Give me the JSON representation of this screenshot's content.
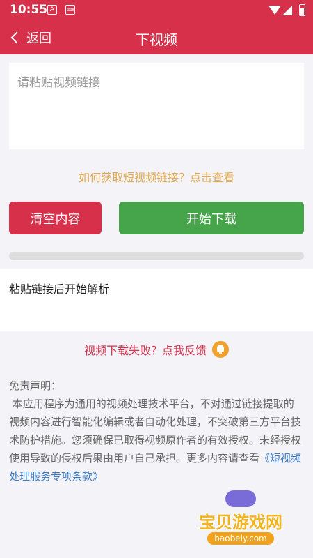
{
  "status_bar": {
    "time": "10:55",
    "notif_icons": [
      "A",
      "keyboard-icon"
    ],
    "system_icons": [
      "wifi-icon",
      "signal-icon",
      "battery-icon"
    ]
  },
  "app_bar": {
    "back_label": "返回",
    "title": "下视频"
  },
  "link_input": {
    "placeholder": "请粘贴视频链接",
    "value": ""
  },
  "howto_link": "如何获取短视频链接？点击查看",
  "actions": {
    "clear_label": "清空内容",
    "start_label": "开始下载"
  },
  "progress": {
    "value": 0
  },
  "status_message": "粘贴链接后开始解析",
  "feedback": {
    "label": "视频下载失败？点我反馈",
    "icon": "bell-icon"
  },
  "disclaimer": {
    "title": "免责声明：",
    "body": "本应用程序为通用的视频处理技术平台，不对通过链接提取的视频内容进行智能化编辑或者自动化处理，不突破第三方平台技术防护措施。您须确保已取得视频原作者的有效授权。未经授权使用导致的侵权后果由用户自己承担。更多内容请查看",
    "terms_link": "《短视频处理服务专项条款》"
  },
  "watermark": {
    "title": "宝贝游戏网",
    "url": "baobeiy.com"
  },
  "colors": {
    "primary_red": "#d6304a",
    "green": "#46a54a",
    "link_orange": "#e2a94c",
    "link_blue": "#3a7ac8"
  }
}
